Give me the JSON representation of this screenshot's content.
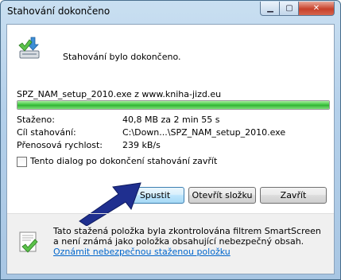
{
  "window": {
    "title": "Stahování dokončeno",
    "controls": {
      "minimize": "▁",
      "maximize": "▢",
      "close": "✕"
    }
  },
  "main": {
    "heading": "Stahování bylo dokončeno.",
    "filename": "SPZ_NAM_setup_2010.exe z www.kniha-jizd.eu",
    "progress": 100,
    "info": [
      {
        "label": "Staženo:",
        "value": "40,8 MB za 2 min 55 s"
      },
      {
        "label": "Cíl stahování:",
        "value": "C:\\Down...\\SPZ_NAM_setup_2010.exe"
      },
      {
        "label": "Přenosová rychlost:",
        "value": "239 kB/s"
      }
    ],
    "checkbox_label": "Tento dialog po dokončení stahování zavřít",
    "checkbox_checked": false
  },
  "buttons": {
    "run": "Spustit",
    "open_folder": "Otevřít složku",
    "close": "Zavřít"
  },
  "footer": {
    "text": "Tato stažená položka byla zkontrolována filtrem SmartScreen a není známá jako položka obsahující nebezpečný obsah.",
    "link": "Oznámit nebezpečnou staženou položku"
  },
  "colors": {
    "progress": "#37c33a",
    "arrow": "#1f2f8f",
    "link": "#0066cc"
  }
}
